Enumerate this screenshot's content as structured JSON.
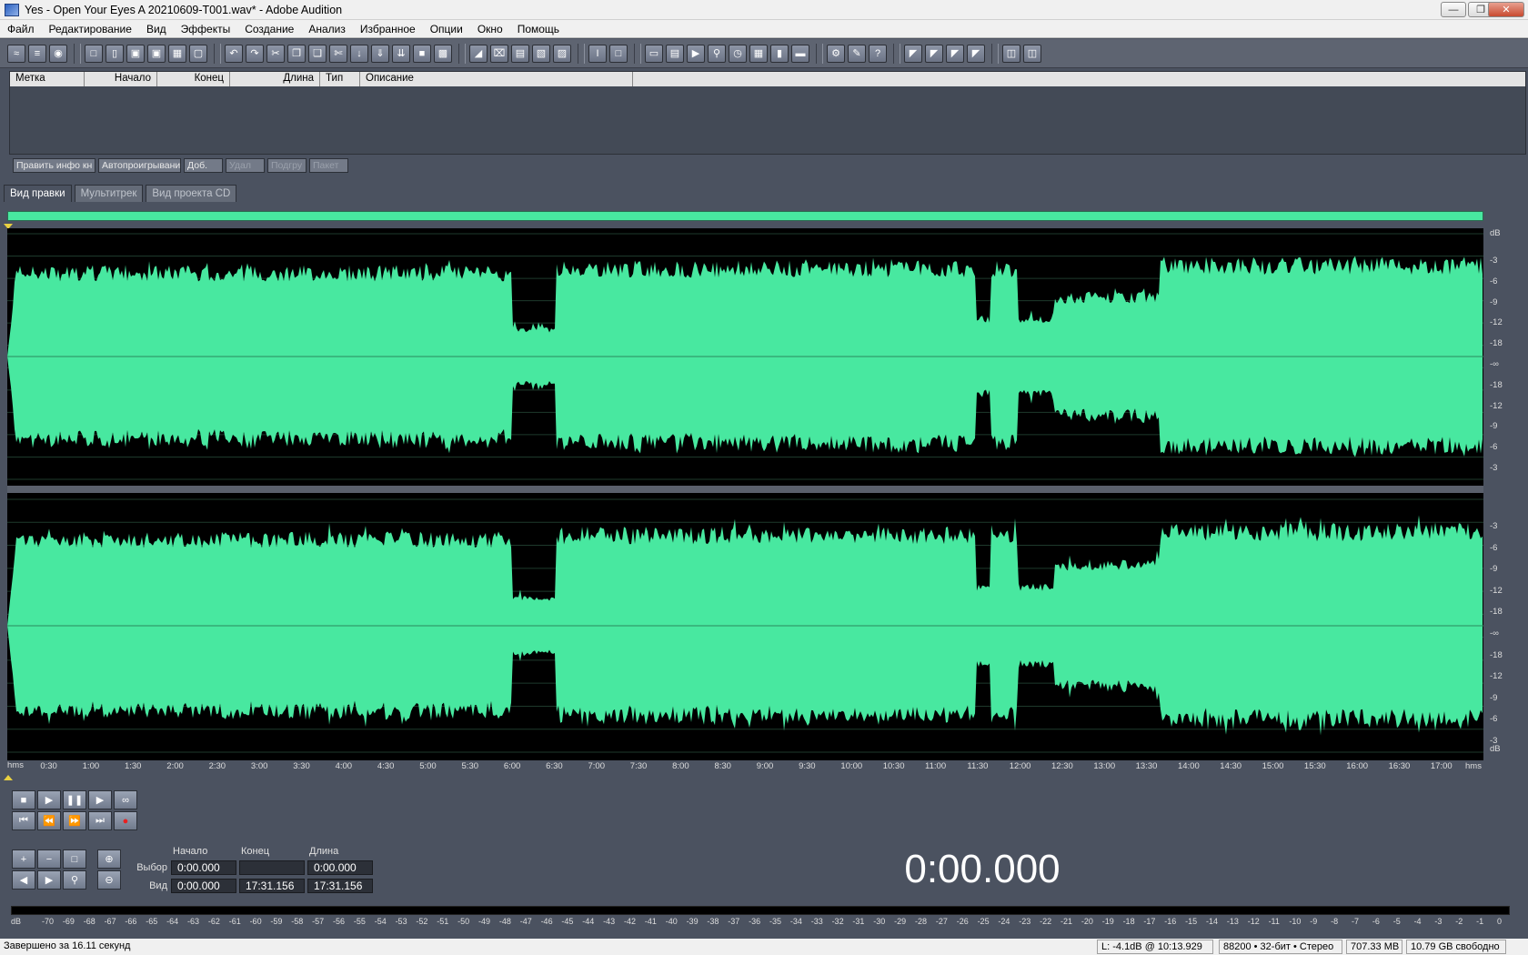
{
  "window": {
    "title": "Yes - Open Your Eyes  A 20210609-T001.wav* - Adobe Audition"
  },
  "menu": [
    "Файл",
    "Редактирование",
    "Вид",
    "Эффекты",
    "Создание",
    "Анализ",
    "Избранное",
    "Опции",
    "Окно",
    "Помощь"
  ],
  "cue_list": {
    "columns": [
      "Метка",
      "Начало",
      "Конец",
      "Длина",
      "Тип",
      "Описание"
    ]
  },
  "cue_buttons": [
    "Править инфо кн",
    "Автопроигрывани",
    "Доб.",
    "Удал",
    "Подгру",
    "Пакет"
  ],
  "view_tabs": [
    "Вид правки",
    "Мультитрек",
    "Вид проекта CD"
  ],
  "active_tab": "Вид правки",
  "db_labels": {
    "top": "dB",
    "bottom": "dB",
    "ch1": [
      "-3",
      "-6",
      "-9",
      "-12",
      "-18",
      "-∞",
      "-18",
      "-12",
      "-9",
      "-6",
      "-3"
    ],
    "ch2": [
      "-3",
      "-6",
      "-9",
      "-12",
      "-18",
      "-∞",
      "-18",
      "-12",
      "-9",
      "-6",
      "-3"
    ]
  },
  "timeline": {
    "unit_label": "hms",
    "marks": [
      "0:30",
      "1:00",
      "1:30",
      "2:00",
      "2:30",
      "3:00",
      "3:30",
      "4:00",
      "4:30",
      "5:00",
      "5:30",
      "6:00",
      "6:30",
      "7:00",
      "7:30",
      "8:00",
      "8:30",
      "9:00",
      "9:30",
      "10:00",
      "10:30",
      "11:00",
      "11:30",
      "12:00",
      "12:30",
      "13:00",
      "13:30",
      "14:00",
      "14:30",
      "15:00",
      "15:30",
      "16:00",
      "16:30",
      "17:00"
    ]
  },
  "selection": {
    "headers": [
      "Начало",
      "Конец",
      "Длина"
    ],
    "row_selection_label": "Выбор",
    "row_view_label": "Вид",
    "selection_values": [
      "0:00.000",
      "",
      "0:00.000"
    ],
    "view_values": [
      "0:00.000",
      "17:31.156",
      "17:31.156"
    ]
  },
  "time_display": "0:00.000",
  "level_meter": {
    "unit": "dB",
    "ticks": [
      "-70",
      "-69",
      "-68",
      "-67",
      "-66",
      "-65",
      "-64",
      "-63",
      "-62",
      "-61",
      "-60",
      "-59",
      "-58",
      "-57",
      "-56",
      "-55",
      "-54",
      "-53",
      "-52",
      "-51",
      "-50",
      "-49",
      "-48",
      "-47",
      "-46",
      "-45",
      "-44",
      "-43",
      "-42",
      "-41",
      "-40",
      "-39",
      "-38",
      "-37",
      "-36",
      "-35",
      "-34",
      "-33",
      "-32",
      "-31",
      "-30",
      "-29",
      "-28",
      "-27",
      "-26",
      "-25",
      "-24",
      "-23",
      "-22",
      "-21",
      "-20",
      "-19",
      "-18",
      "-17",
      "-16",
      "-15",
      "-14",
      "-13",
      "-12",
      "-11",
      "-10",
      "-9",
      "-8",
      "-7",
      "-6",
      "-5",
      "-4",
      "-3",
      "-2",
      "-1",
      "0"
    ]
  },
  "status": {
    "message": "Завершено за 16.11 секунд",
    "level": "L: -4.1dB @  10:13.929",
    "format": "88200 • 32-бит • Стерео",
    "size": "707.33 MB",
    "free": "10.79 GB свободно"
  },
  "colors": {
    "waveform": "#48e8a0",
    "background": "#000000",
    "panel": "#4b5260"
  },
  "waveform_envelope": {
    "duration_seconds": 1051.156,
    "segments": [
      {
        "from_s": 0,
        "to_s": 360,
        "level": 0.78
      },
      {
        "from_s": 360,
        "to_s": 390,
        "level": 0.25
      },
      {
        "from_s": 390,
        "to_s": 690,
        "level": 0.82
      },
      {
        "from_s": 690,
        "to_s": 700,
        "level": 0.35
      },
      {
        "from_s": 700,
        "to_s": 720,
        "level": 0.82
      },
      {
        "from_s": 720,
        "to_s": 745,
        "level": 0.35
      },
      {
        "from_s": 745,
        "to_s": 820,
        "level": 0.55
      },
      {
        "from_s": 820,
        "to_s": 1051,
        "level": 0.85
      }
    ]
  }
}
